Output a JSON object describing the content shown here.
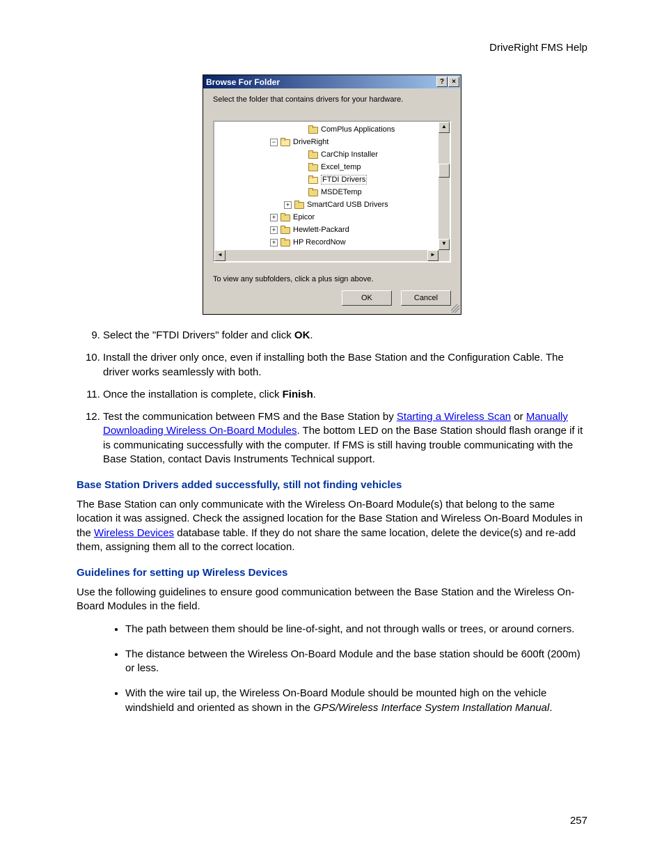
{
  "header": "DriveRight FMS Help",
  "dialog": {
    "title": "Browse For Folder",
    "helpBtn": "?",
    "closeBtn": "×",
    "instruction": "Select the folder that contains drivers for your hardware.",
    "tree": [
      {
        "indent": 120,
        "expander": "",
        "label": "ComPlus Applications",
        "open": false
      },
      {
        "indent": 80,
        "expander": "-",
        "label": "DriveRight",
        "open": true
      },
      {
        "indent": 120,
        "expander": "",
        "label": "CarChip Installer",
        "open": false
      },
      {
        "indent": 120,
        "expander": "",
        "label": "Excel_temp",
        "open": false
      },
      {
        "indent": 120,
        "expander": "",
        "label": "FTDI Drivers",
        "open": true,
        "selected": true
      },
      {
        "indent": 120,
        "expander": "",
        "label": "MSDETemp",
        "open": false
      },
      {
        "indent": 100,
        "expander": "+",
        "label": "SmartCard USB Drivers",
        "open": false
      },
      {
        "indent": 80,
        "expander": "+",
        "label": "Epicor",
        "open": false
      },
      {
        "indent": 80,
        "expander": "+",
        "label": "Hewlett-Packard",
        "open": false
      },
      {
        "indent": 80,
        "expander": "+",
        "label": "HP RecordNow",
        "open": false
      }
    ],
    "hint": "To view any subfolders, click a plus sign above.",
    "ok": "OK",
    "cancel": "Cancel"
  },
  "steps": {
    "s9a": "Select the \"FTDI Drivers\" folder and click ",
    "s9b": "OK",
    "s9c": ".",
    "s10": "Install the driver only once, even if installing both the Base Station and the Configuration Cable. The driver works seamlessly with both.",
    "s11a": "Once the installation is complete, click ",
    "s11b": "Finish",
    "s11c": ".",
    "s12a": "Test the communication between FMS and the Base Station by ",
    "s12link1": "Starting a Wireless Scan",
    "s12b": " or ",
    "s12link2": "Manually Downloading Wireless On-Board Modules",
    "s12c": ". The bottom LED on the Base Station should flash orange if it is communicating successfully with the computer. If FMS is still having trouble communicating with the Base Station, contact Davis Instruments Technical support."
  },
  "section1": {
    "title": "Base Station Drivers added successfully, still not finding vehicles",
    "p_a": "The Base Station can only communicate with the Wireless On-Board Module(s) that belong to the same location it was assigned. Check the assigned location for the Base Station and Wireless On-Board Modules in the ",
    "p_link": "Wireless Devices",
    "p_b": " database table. If they do not share the same location, delete the device(s) and re-add them, assigning them all to the correct location."
  },
  "section2": {
    "title": "Guidelines for setting up Wireless Devices",
    "intro": "Use the following guidelines to ensure good communication between the Base Station and the Wireless On-Board Modules in the field.",
    "b1": "The path between them should be line-of-sight, and not through walls or trees, or around corners.",
    "b2": "The distance between the Wireless On-Board Module and the base station should be 600ft (200m) or less.",
    "b3a": " With the wire tail up, the Wireless On-Board Module should be mounted high on the vehicle windshield and oriented as shown in the ",
    "b3i": "GPS/Wireless Interface System Installation Manual",
    "b3b": "."
  },
  "pageNumber": "257"
}
